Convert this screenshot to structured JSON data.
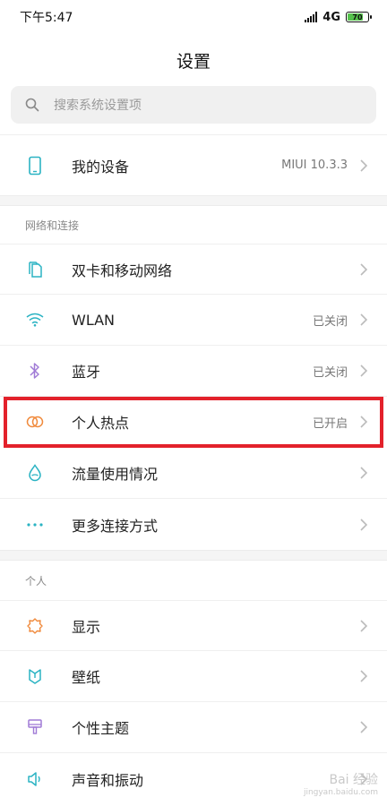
{
  "status_bar": {
    "time": "下午5:47",
    "network": "4G",
    "battery": "70"
  },
  "header": {
    "title": "设置"
  },
  "search": {
    "placeholder": "搜索系统设置项"
  },
  "device": {
    "label": "我的设备",
    "value": "MIUI 10.3.3"
  },
  "sections": {
    "network": {
      "title": "网络和连接",
      "items": [
        {
          "label": "双卡和移动网络",
          "value": ""
        },
        {
          "label": "WLAN",
          "value": "已关闭"
        },
        {
          "label": "蓝牙",
          "value": "已关闭"
        },
        {
          "label": "个人热点",
          "value": "已开启"
        },
        {
          "label": "流量使用情况",
          "value": ""
        },
        {
          "label": "更多连接方式",
          "value": ""
        }
      ]
    },
    "personal": {
      "title": "个人",
      "items": [
        {
          "label": "显示"
        },
        {
          "label": "壁纸"
        },
        {
          "label": "个性主题"
        },
        {
          "label": "声音和振动"
        }
      ]
    }
  },
  "watermark": {
    "text": "Bai 经验",
    "sub": "jingyan.baidu.com"
  },
  "icons": {
    "device": "phone-icon",
    "sim": "sim-card-icon",
    "wifi": "wifi-icon",
    "bluetooth": "bluetooth-icon",
    "hotspot": "hotspot-icon",
    "data": "water-drop-icon",
    "more": "more-dots-icon",
    "display": "brightness-icon",
    "wallpaper": "wallpaper-icon",
    "theme": "theme-brush-icon",
    "sound": "speaker-icon"
  },
  "colors": {
    "highlight": "#e3212b",
    "accent_teal": "#2bb3c3",
    "accent_orange": "#f08a3c",
    "accent_purple": "#a07bd6"
  }
}
